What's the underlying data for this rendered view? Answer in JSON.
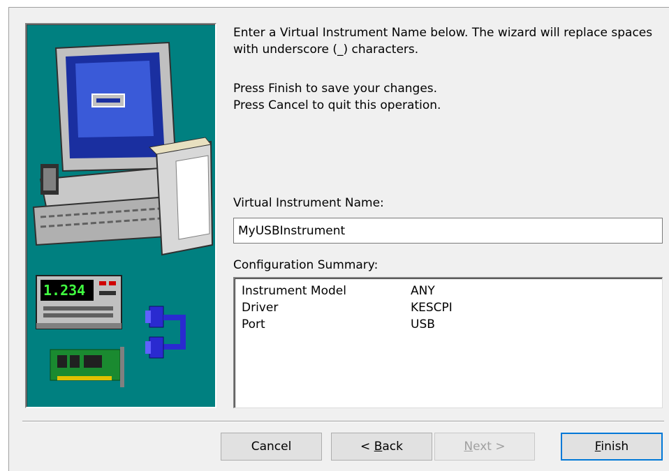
{
  "intro_text": "Enter a Virtual Instrument Name below. The wizard will replace spaces with underscore (_) characters.",
  "instructions": {
    "line1": "Press Finish to save your changes.",
    "line2": "Press Cancel to quit this operation."
  },
  "vi_name": {
    "label": "Virtual Instrument Name:",
    "value": "MyUSBInstrument"
  },
  "config": {
    "label": "Configuration Summary:",
    "rows": [
      {
        "key": "Instrument Model",
        "value": "ANY"
      },
      {
        "key": "Driver",
        "value": "KESCPI"
      },
      {
        "key": "Port",
        "value": "USB"
      }
    ]
  },
  "illustration": {
    "meter_display": "1.234"
  },
  "buttons": {
    "cancel": "Cancel",
    "back_prefix": "< ",
    "back_mnemonic": "B",
    "back_rest": "ack",
    "next_mnemonic": "N",
    "next_rest": "ext >",
    "finish_mnemonic": "F",
    "finish_rest": "inish"
  },
  "icons": [
    "computer-icon",
    "multimeter-icon",
    "usb-connector-icon",
    "interface-card-icon"
  ]
}
